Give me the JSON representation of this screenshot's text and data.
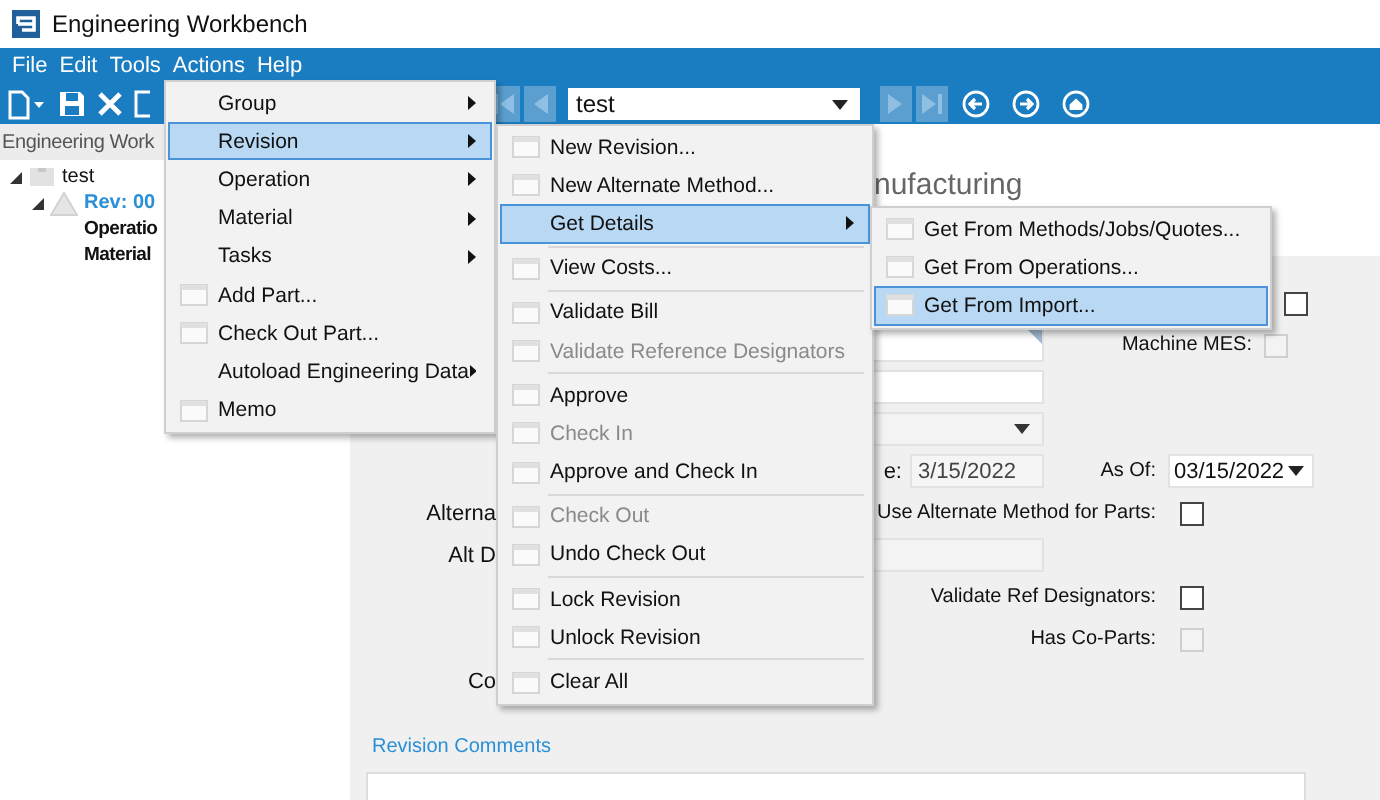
{
  "window": {
    "title": "Engineering Workbench"
  },
  "menubar": [
    "File",
    "Edit",
    "Tools",
    "Actions",
    "Help"
  ],
  "toolbar": {
    "combo_value": "test"
  },
  "tree": {
    "header": "Engineering Work",
    "items": [
      {
        "label": "test",
        "expanded": true,
        "children": [
          {
            "label": "Rev: 00",
            "expanded": true,
            "children": [
              {
                "label": "Operatio"
              },
              {
                "label": "Material"
              }
            ]
          }
        ]
      }
    ]
  },
  "form": {
    "heading": "nufacturing",
    "top_checkbox": {
      "checked": false
    },
    "machine_mes": {
      "label": "Machine MES:",
      "checked": false,
      "disabled": true
    },
    "date_label": "e:",
    "date_value": "3/15/2022",
    "as_of": {
      "label": "As Of:",
      "value": "03/15/2022"
    },
    "alt_label": "Alterna",
    "use_alternate": {
      "label": "Use Alternate Method for Parts:",
      "checked": false,
      "disabled": false
    },
    "alt_d_label": "Alt D",
    "validate_ref": {
      "label": "Validate Ref Designators:",
      "checked": false,
      "disabled": false
    },
    "has_co_parts": {
      "label": "Has Co-Parts:",
      "checked": false,
      "disabled": true
    },
    "co_label": "Co",
    "comments_label": "Revision Comments"
  },
  "menus": [
    {
      "items": [
        {
          "label": "Group",
          "kind": "submenu",
          "icon": false,
          "selected": false,
          "disabled": false,
          "separator_before": false
        },
        {
          "label": "Revision",
          "kind": "submenu",
          "icon": false,
          "selected": true,
          "disabled": false,
          "separator_before": false
        },
        {
          "label": "Operation",
          "kind": "submenu",
          "icon": false,
          "selected": false,
          "disabled": false,
          "separator_before": false
        },
        {
          "label": "Material",
          "kind": "submenu",
          "icon": false,
          "selected": false,
          "disabled": false,
          "separator_before": false
        },
        {
          "label": "Tasks",
          "kind": "submenu",
          "icon": false,
          "selected": false,
          "disabled": false,
          "separator_before": false
        },
        {
          "label": "Add Part...",
          "kind": "command",
          "icon": true,
          "selected": false,
          "disabled": false,
          "separator_before": false
        },
        {
          "label": "Check Out Part...",
          "kind": "command",
          "icon": true,
          "selected": false,
          "disabled": false,
          "separator_before": false
        },
        {
          "label": "Autoload Engineering Data",
          "kind": "submenu",
          "icon": false,
          "selected": false,
          "disabled": false,
          "separator_before": false
        },
        {
          "label": "Memo",
          "kind": "command",
          "icon": true,
          "selected": false,
          "disabled": false,
          "separator_before": false
        }
      ]
    },
    {
      "items": [
        {
          "label": "New Revision...",
          "kind": "command",
          "icon": true,
          "selected": false,
          "disabled": false,
          "separator_before": false
        },
        {
          "label": "New Alternate Method...",
          "kind": "command",
          "icon": true,
          "selected": false,
          "disabled": false,
          "separator_before": false
        },
        {
          "label": "Get Details",
          "kind": "submenu",
          "icon": false,
          "selected": true,
          "disabled": false,
          "separator_before": false
        },
        {
          "label": "View Costs...",
          "kind": "command",
          "icon": true,
          "selected": false,
          "disabled": false,
          "separator_before": true
        },
        {
          "label": "Validate Bill",
          "kind": "command",
          "icon": true,
          "selected": false,
          "disabled": false,
          "separator_before": true
        },
        {
          "label": "Validate Reference Designators",
          "kind": "command",
          "icon": true,
          "selected": false,
          "disabled": true,
          "separator_before": false
        },
        {
          "label": "Approve",
          "kind": "command",
          "icon": true,
          "selected": false,
          "disabled": false,
          "separator_before": true
        },
        {
          "label": "Check In",
          "kind": "command",
          "icon": true,
          "selected": false,
          "disabled": true,
          "separator_before": false
        },
        {
          "label": "Approve and Check In",
          "kind": "command",
          "icon": true,
          "selected": false,
          "disabled": false,
          "separator_before": false
        },
        {
          "label": "Check Out",
          "kind": "command",
          "icon": true,
          "selected": false,
          "disabled": true,
          "separator_before": true
        },
        {
          "label": "Undo Check Out",
          "kind": "command",
          "icon": true,
          "selected": false,
          "disabled": false,
          "separator_before": false
        },
        {
          "label": "Lock Revision",
          "kind": "command",
          "icon": true,
          "selected": false,
          "disabled": false,
          "separator_before": true
        },
        {
          "label": "Unlock Revision",
          "kind": "command",
          "icon": true,
          "selected": false,
          "disabled": false,
          "separator_before": false
        },
        {
          "label": "Clear All",
          "kind": "command",
          "icon": true,
          "selected": false,
          "disabled": false,
          "separator_before": true
        }
      ]
    },
    {
      "items": [
        {
          "label": "Get From Methods/Jobs/Quotes...",
          "kind": "command",
          "icon": true,
          "selected": false,
          "disabled": false,
          "separator_before": false
        },
        {
          "label": "Get From Operations...",
          "kind": "command",
          "icon": true,
          "selected": false,
          "disabled": false,
          "separator_before": false
        },
        {
          "label": "Get From Import...",
          "kind": "command",
          "icon": true,
          "selected": true,
          "disabled": false,
          "separator_before": false
        }
      ]
    }
  ]
}
